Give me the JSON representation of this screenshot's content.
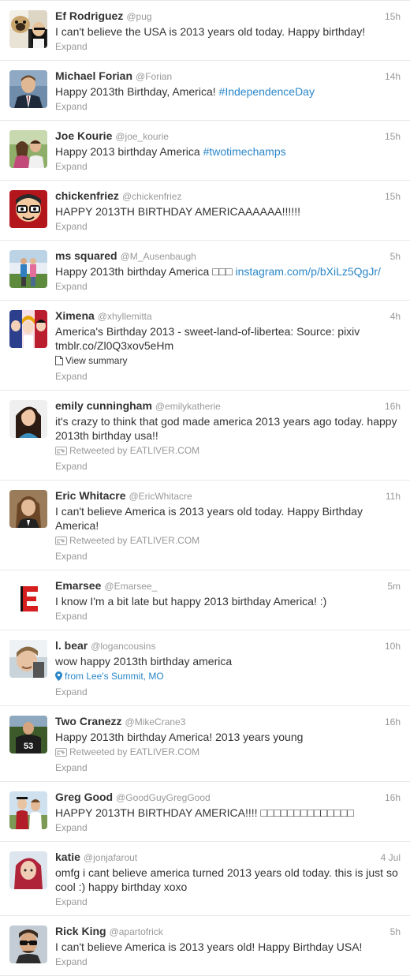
{
  "ui": {
    "expand_label": "Expand",
    "retweeted_prefix": "Retweeted by "
  },
  "colors": {
    "link": "#2a86c8",
    "muted": "#999999",
    "text": "#333333",
    "divider": "#e8e8e8"
  },
  "tweets": [
    {
      "name": "Ef Rodriguez",
      "handle": "@pug",
      "time": "15h",
      "text": [
        {
          "t": "I can't believe the USA is 2013 years old today. Happy birthday!"
        }
      ],
      "avatar": "pug-avatar"
    },
    {
      "name": "Michael Forian",
      "handle": "@Forian",
      "time": "14h",
      "text": [
        {
          "t": "Happy 2013th Birthday, America! "
        },
        {
          "t": "#IndependenceDay",
          "link": true
        }
      ],
      "avatar": "man-in-suit-avatar"
    },
    {
      "name": "Joe Kourie",
      "handle": "@joe_kourie",
      "time": "15h",
      "text": [
        {
          "t": "Happy 2013 birthday America "
        },
        {
          "t": "#twotimechamps",
          "link": true
        }
      ],
      "avatar": "couple-photo-avatar"
    },
    {
      "name": "chickenfriez",
      "handle": "@chickenfriez",
      "time": "15h",
      "text": [
        {
          "t": "HAPPY 2013TH BIRTHDAY AMERICAAAAAA!!!!!!"
        }
      ],
      "avatar": "cartoon-face-avatar"
    },
    {
      "name": "ms squared",
      "handle": "@M_Ausenbaugh",
      "time": "5h",
      "text": [
        {
          "t": "Happy 2013th birthday America □□□ "
        },
        {
          "t": "instagram.com/p/bXiLz5QgJr/",
          "link": true
        }
      ],
      "avatar": "outdoor-people-avatar"
    },
    {
      "name": "Ximena",
      "handle": "@xhyllemitta",
      "time": "4h",
      "text": [
        {
          "t": "America's Birthday 2013 - sweet-land-of-libertea: Source: pixiv"
        },
        {
          "t": " tmblr.co/Zl0Q3xov5eHm",
          "br": true
        }
      ],
      "meta": {
        "kind": "summary",
        "label": "View summary"
      },
      "avatar": "anime-art-avatar"
    },
    {
      "name": "emily cunningham",
      "handle": "@emilykatherie",
      "time": "16h",
      "text": [
        {
          "t": "it's crazy to think that god made america 2013 years ago today. happy 2013th birthday usa!!"
        }
      ],
      "meta": {
        "kind": "retweet",
        "label": "EATLIVER.COM"
      },
      "avatar": "girl-portrait-avatar"
    },
    {
      "name": "Eric Whitacre",
      "handle": "@EricWhitacre",
      "time": "11h",
      "text": [
        {
          "t": "I can't believe America is 2013 years old today. Happy Birthday America!"
        }
      ],
      "meta": {
        "kind": "retweet",
        "label": "EATLIVER.COM"
      },
      "avatar": "long-hair-man-avatar"
    },
    {
      "name": "Emarsee",
      "handle": "@Emarsee_",
      "time": "5m",
      "text": [
        {
          "t": "I know I'm a bit late but happy 2013 birthday America! :)"
        }
      ],
      "avatar": "letter-e-logo-avatar"
    },
    {
      "name": "l. bear",
      "handle": "@logancousins",
      "time": "10h",
      "text": [
        {
          "t": "wow happy 2013th birthday america"
        }
      ],
      "meta": {
        "kind": "location",
        "label": "from Lee's Summit, MO"
      },
      "avatar": "selfie-avatar"
    },
    {
      "name": "Two Cranezz",
      "handle": "@MikeCrane3",
      "time": "16h",
      "text": [
        {
          "t": "Happy 2013th birthday America! 2013 years young"
        }
      ],
      "meta": {
        "kind": "retweet",
        "label": "EATLIVER.COM"
      },
      "avatar": "football-player-avatar"
    },
    {
      "name": "Greg Good",
      "handle": "@GoodGuyGregGood",
      "time": "16h",
      "text": [
        {
          "t": "HAPPY 2013TH BIRTHDAY AMERICA!!!! □□□□□□□□□□□□□□"
        }
      ],
      "avatar": "graduation-avatar"
    },
    {
      "name": "katie",
      "handle": "@jonjafarout",
      "time": "4 Jul",
      "text": [
        {
          "t": "omfg i cant believe america turned 2013 years old today. this is just so cool :) happy birthday xoxo"
        }
      ],
      "avatar": "red-hair-girl-avatar"
    },
    {
      "name": "Rick King",
      "handle": "@apartofrick",
      "time": "5h",
      "text": [
        {
          "t": "I can't believe America is 2013 years old! Happy Birthday USA!"
        }
      ],
      "avatar": "sunglasses-man-avatar"
    }
  ]
}
